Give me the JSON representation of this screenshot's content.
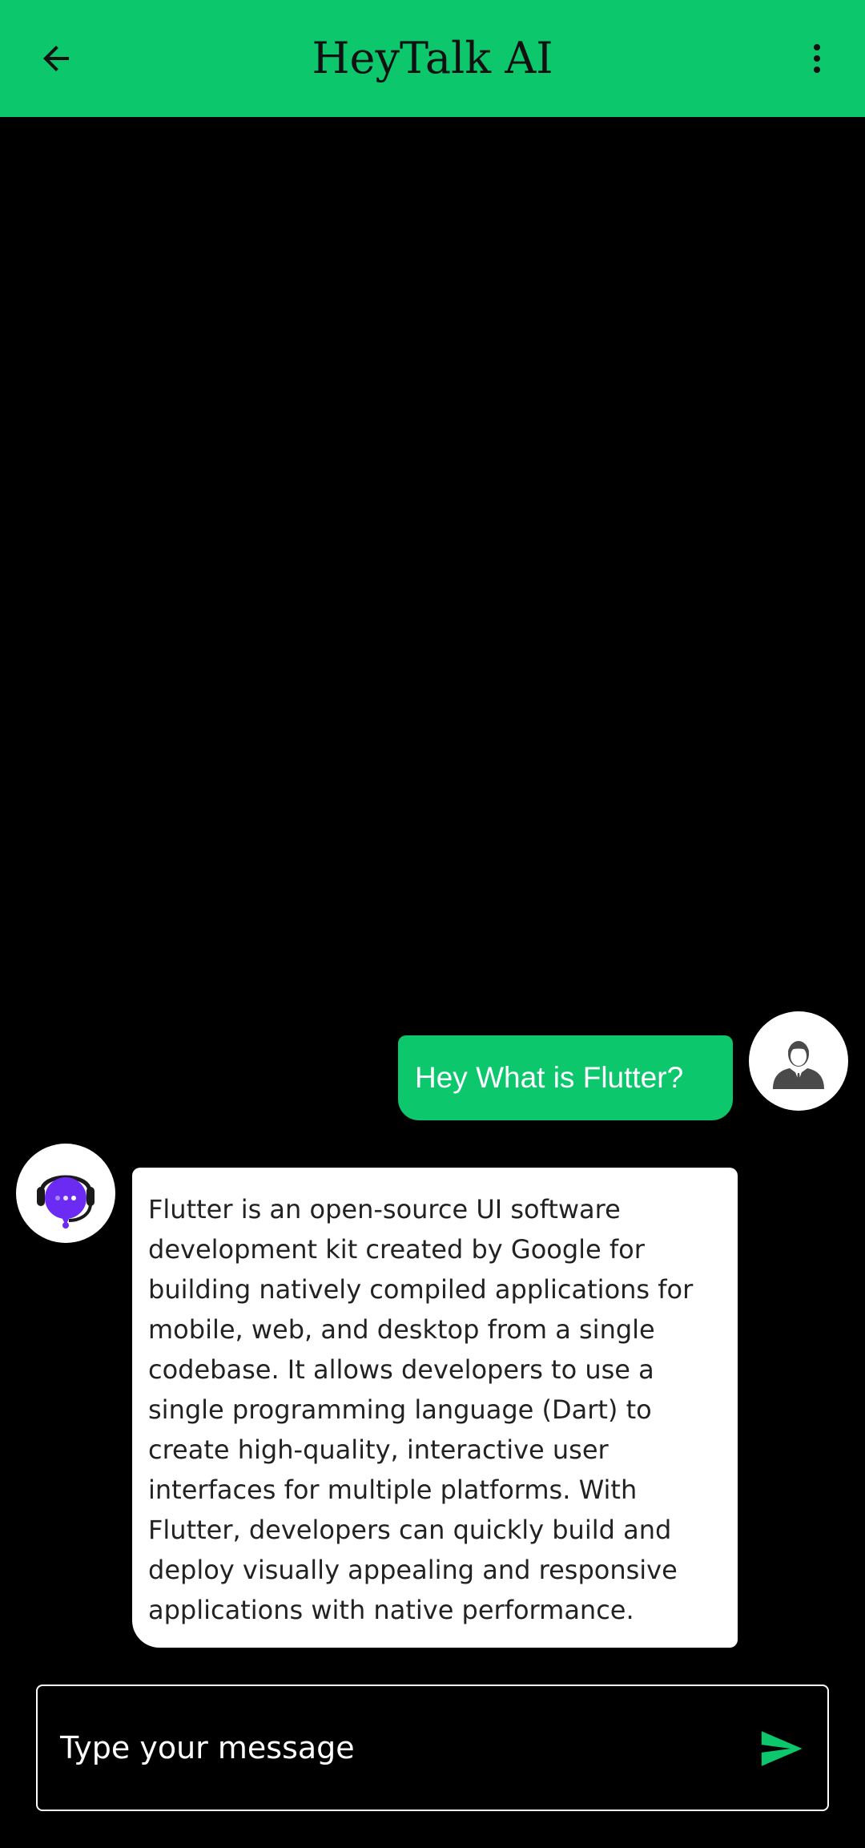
{
  "app_bar": {
    "title": "HeyTalk AI",
    "background_color": "#0CC76C",
    "back_icon": "arrow-back-icon",
    "menu_icon": "more-vert-icon"
  },
  "messages": [
    {
      "sender": "user",
      "text": "Hey What is Flutter?",
      "avatar_icon": "user-avatar-icon",
      "bubble_color": "#0CC76C"
    },
    {
      "sender": "bot",
      "text": "Flutter is an open-source UI software development kit created by Google for building natively compiled applications for mobile, web, and desktop from a single codebase. It allows developers to use a single programming language (Dart) to create high-quality, interactive user interfaces for multiple platforms. With Flutter, developers can quickly build and deploy visually appealing and responsive applications with native performance.",
      "avatar_icon": "bot-headset-icon",
      "bubble_color": "#FFFFFF"
    }
  ],
  "composer": {
    "placeholder": "Type your message",
    "value": "",
    "send_icon": "send-icon",
    "send_color": "#0CC76C"
  }
}
